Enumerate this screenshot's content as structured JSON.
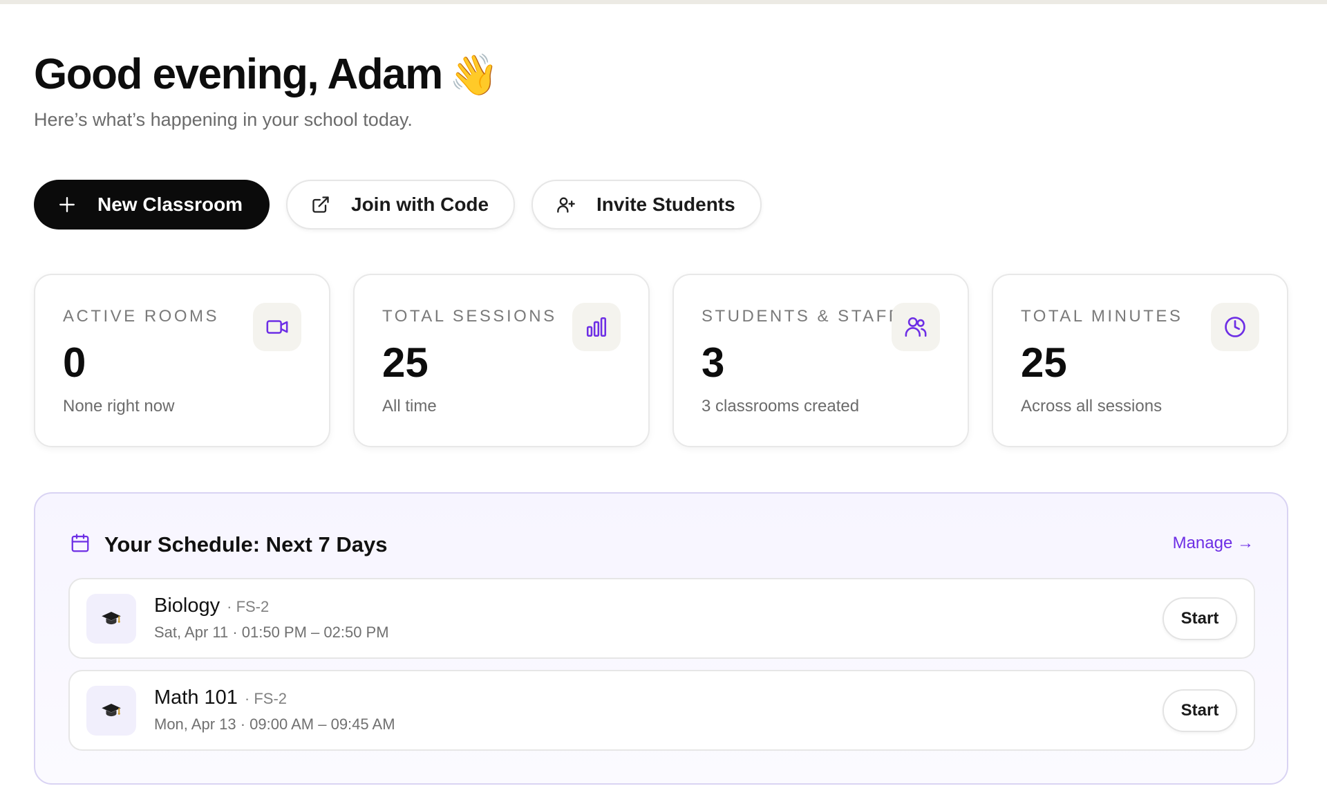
{
  "header": {
    "greeting": "Good evening, Adam",
    "greeting_emoji": "👋",
    "subtitle": "Here’s what’s happening in your school today."
  },
  "actions": {
    "new_classroom": "New Classroom",
    "join_with_code": "Join with Code",
    "invite_students": "Invite Students"
  },
  "stats": [
    {
      "label": "ACTIVE ROOMS",
      "value": "0",
      "note": "None right now",
      "icon": "video-icon"
    },
    {
      "label": "TOTAL SESSIONS",
      "value": "25",
      "note": "All time",
      "icon": "bar-chart-icon"
    },
    {
      "label": "STUDENTS & STAFF",
      "value": "3",
      "note": "3 classrooms created",
      "icon": "users-icon"
    },
    {
      "label": "TOTAL MINUTES",
      "value": "25",
      "note": "Across all sessions",
      "icon": "clock-icon"
    }
  ],
  "schedule": {
    "title": "Your Schedule: Next 7 Days",
    "manage_label": "Manage →",
    "items": [
      {
        "icon": "graduation-cap-icon",
        "name": "Biology",
        "code": "· FS-2",
        "when": "Sat, Apr 11 · 01:50 PM – 02:50 PM",
        "start_label": "Start"
      },
      {
        "icon": "graduation-cap-icon",
        "name": "Math 101",
        "code": "· FS-2",
        "when": "Mon, Apr 13 · 09:00 AM – 09:45 AM",
        "start_label": "Start"
      }
    ]
  },
  "colors": {
    "accent": "#6d2ee5",
    "primary_button": "#0b0b0b",
    "schedule_border": "#d9d3f3"
  }
}
